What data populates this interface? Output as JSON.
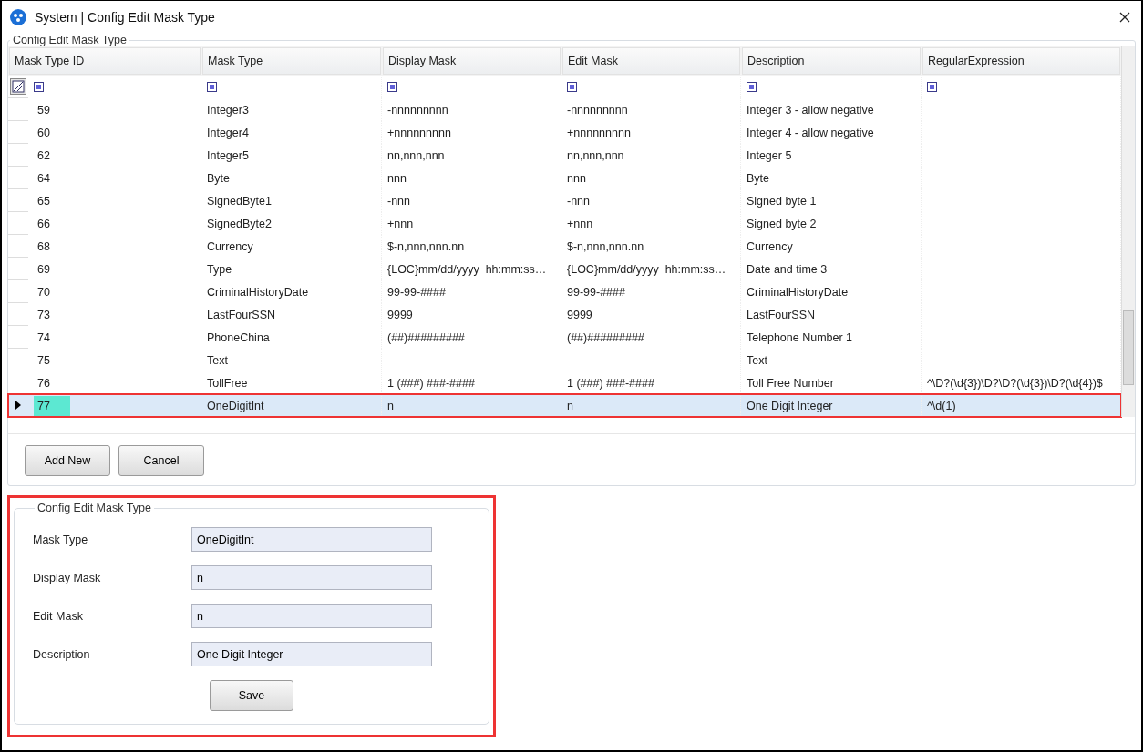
{
  "window": {
    "title": "System | Config Edit Mask Type"
  },
  "grid_group": {
    "title": "Config Edit Mask Type"
  },
  "table": {
    "columns": [
      "Mask Type ID",
      "Mask Type",
      "Display Mask",
      "Edit Mask",
      "Description",
      "RegularExpression"
    ],
    "rows": [
      {
        "cells": [
          "59",
          "Integer3",
          "-nnnnnnnnn",
          "-nnnnnnnnn",
          "Integer 3 - allow negative",
          ""
        ],
        "selected": false
      },
      {
        "cells": [
          "60",
          "Integer4",
          "+nnnnnnnnn",
          "+nnnnnnnnn",
          "Integer 4 - allow negative",
          ""
        ],
        "selected": false
      },
      {
        "cells": [
          "62",
          "Integer5",
          "nn,nnn,nnn",
          "nn,nnn,nnn",
          "Integer 5",
          ""
        ],
        "selected": false
      },
      {
        "cells": [
          "64",
          "Byte",
          "nnn",
          "nnn",
          "Byte",
          ""
        ],
        "selected": false
      },
      {
        "cells": [
          "65",
          "SignedByte1",
          "-nnn",
          "-nnn",
          "Signed byte 1",
          ""
        ],
        "selected": false
      },
      {
        "cells": [
          "66",
          "SignedByte2",
          "+nnn",
          "+nnn",
          "Signed byte 2",
          ""
        ],
        "selected": false
      },
      {
        "cells": [
          "68",
          "Currency",
          "$-n,nnn,nnn.nn",
          "$-n,nnn,nnn.nn",
          "Currency",
          ""
        ],
        "selected": false
      },
      {
        "cells": [
          "69",
          "Type",
          "{LOC}mm/dd/yyyy  hh:mm:ss…",
          "{LOC}mm/dd/yyyy  hh:mm:ss…",
          "Date and time 3",
          ""
        ],
        "selected": false
      },
      {
        "cells": [
          "70",
          "CriminalHistoryDate",
          "99-99-####",
          "99-99-####",
          "CriminalHistoryDate",
          ""
        ],
        "selected": false
      },
      {
        "cells": [
          "73",
          "LastFourSSN",
          "9999",
          "9999",
          "LastFourSSN",
          ""
        ],
        "selected": false
      },
      {
        "cells": [
          "74",
          "PhoneChina",
          "(##)#########",
          "(##)#########",
          "Telephone Number 1",
          ""
        ],
        "selected": false
      },
      {
        "cells": [
          "75",
          "Text",
          "",
          "",
          "Text",
          ""
        ],
        "selected": false
      },
      {
        "cells": [
          "76",
          "TollFree",
          "1 (###) ###-####",
          "1 (###) ###-####",
          "Toll Free Number",
          "^\\D?(\\d{3})\\D?\\D?(\\d{3})\\D?(\\d{4})$"
        ],
        "selected": false
      },
      {
        "cells": [
          "77",
          "OneDigitInt",
          "n",
          "n",
          "One Digit Integer",
          "^\\d(1)"
        ],
        "selected": true
      }
    ]
  },
  "buttons": [
    "Add New",
    "Cancel"
  ],
  "form": {
    "title": "Config Edit Mask Type",
    "highlighted": true,
    "fields": [
      {
        "label": "Mask Type",
        "value": "OneDigitInt"
      },
      {
        "label": "Display Mask",
        "value": "n"
      },
      {
        "label": "Edit Mask",
        "value": "n"
      },
      {
        "label": "Description",
        "value": "One Digit Integer"
      }
    ],
    "save_button": "Save"
  }
}
